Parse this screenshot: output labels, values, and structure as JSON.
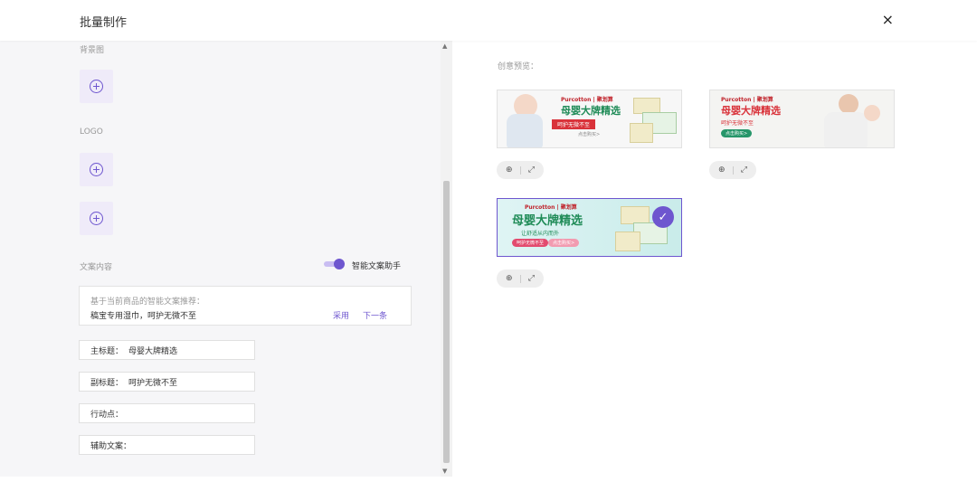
{
  "header": {
    "title": "批量制作",
    "close_label": "×"
  },
  "left_panel": {
    "background_label": "背景图",
    "logo_label": "LOGO",
    "copy_label": "文案内容",
    "assistant_toggle": {
      "label": "智能文案助手",
      "on": true
    },
    "suggestion": {
      "hint": "基于当前商品的智能文案推荐：",
      "text": "稿宝专用湿巾，呵护无微不至",
      "apply_label": "采用",
      "next_label": "下一条"
    },
    "fields": [
      {
        "label": "主标题：",
        "value": "母婴大牌精选"
      },
      {
        "label": "副标题：",
        "value": "呵护无微不至"
      },
      {
        "label": "行动点：",
        "value": ""
      },
      {
        "label": "辅助文案：",
        "value": ""
      }
    ]
  },
  "right_panel": {
    "preview_label": "创意预览：",
    "banners": [
      {
        "brand": "Purcotton | 聚划算",
        "title": "母婴大牌精选",
        "subtitle": "呵护无微不至",
        "cta": "点击购买>",
        "selected": false
      },
      {
        "brand": "Purcotton | 聚划算",
        "title": "母婴大牌精选",
        "subtitle": "呵护无微不至",
        "cta": "点击购买>",
        "selected": false
      },
      {
        "brand": "Purcotton | 聚划算",
        "title": "母婴大牌精选",
        "subtitle": "让舒适从内而外",
        "cta": "点击购买>",
        "tag": "呵护无微不至",
        "selected": true
      }
    ],
    "tools": {
      "zoom_icon": "⊕",
      "expand_icon": "⤢"
    }
  },
  "colors": {
    "accent": "#6e56cf",
    "panel_bg": "#f6f6f8",
    "brand_green": "#1f8b57",
    "brand_red": "#d9323a"
  }
}
